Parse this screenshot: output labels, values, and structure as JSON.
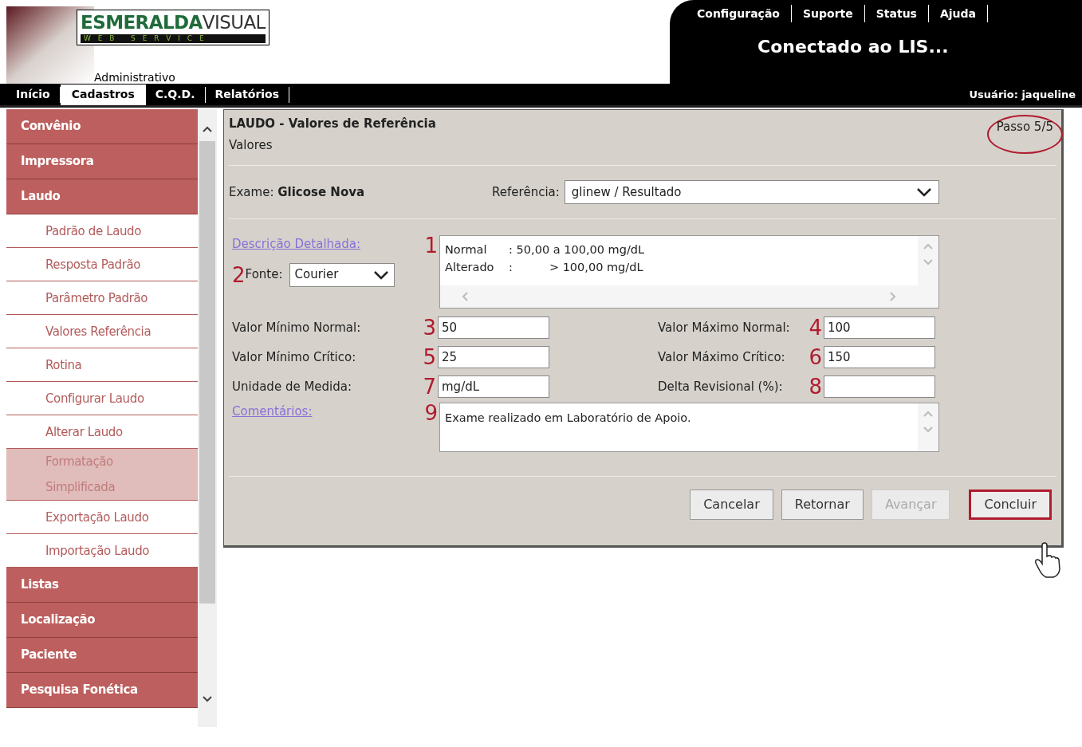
{
  "header": {
    "logo_text": "ESMERALDA",
    "logo_text2": "VISUAL",
    "logo_sub": "W E B   S E R V I C E",
    "area": "Administrativo",
    "top_links": [
      "Configuração",
      "Suporte",
      "Status",
      "Ajuda"
    ],
    "banner": "Conectado ao LIS...",
    "user": "Usuário: jaqueline"
  },
  "nav_tabs": [
    {
      "label": "Início",
      "selected": false
    },
    {
      "label": "Cadastros",
      "selected": true
    },
    {
      "label": "C.Q.D.",
      "selected": false
    },
    {
      "label": "Relatórios",
      "selected": false
    }
  ],
  "sidebar": {
    "items": [
      {
        "label": "Convênio",
        "kind": "category",
        "selected": false
      },
      {
        "label": "Impressora",
        "kind": "category",
        "selected": false
      },
      {
        "label": "Laudo",
        "kind": "category",
        "selected": false
      },
      {
        "label": "Padrão de Laudo",
        "kind": "subitem",
        "selected": false
      },
      {
        "label": "Resposta Padrão",
        "kind": "subitem",
        "selected": false
      },
      {
        "label": "Parâmetro Padrão",
        "kind": "subitem",
        "selected": false
      },
      {
        "label": "Valores Referência",
        "kind": "subitem",
        "selected": false
      },
      {
        "label": "Rotina",
        "kind": "subitem",
        "selected": false
      },
      {
        "label": "Configurar Laudo",
        "kind": "subitem",
        "selected": false
      },
      {
        "label": "Alterar Laudo",
        "kind": "subitem",
        "selected": false
      },
      {
        "label": "Formatação Simplificada",
        "kind": "subitem",
        "selected": true
      },
      {
        "label": "Exportação Laudo",
        "kind": "subitem",
        "selected": false
      },
      {
        "label": "Importação Laudo",
        "kind": "subitem",
        "selected": false
      },
      {
        "label": "Listas",
        "kind": "category",
        "selected": false
      },
      {
        "label": "Localização",
        "kind": "category",
        "selected": false
      },
      {
        "label": "Paciente",
        "kind": "category",
        "selected": false
      },
      {
        "label": "Pesquisa Fonética",
        "kind": "category",
        "selected": false
      }
    ]
  },
  "panel": {
    "title": "LAUDO - Valores de Referência",
    "subtitle": "Valores",
    "step": "Passo 5/5",
    "exam_label": "Exame:",
    "exam_value": "Glicose Nova",
    "reference_label": "Referência:",
    "reference_value": "glinew / Resultado",
    "description_link": "Descrição Detalhada:",
    "description_marker": "1",
    "description_lines": [
      "Normal      : 50,00 a 100,00 mg/dL",
      "Alterado    :          > 100,00 mg/dL"
    ],
    "font_marker": "2",
    "font_label": "Fonte:",
    "font_value": "Courier",
    "fields": [
      {
        "label": "Valor Mínimo Normal:",
        "marker": "3",
        "value": "50"
      },
      {
        "label": "Valor Máximo Normal:",
        "marker": "4",
        "value": "100"
      },
      {
        "label": "Valor Mínimo Crítico:",
        "marker": "5",
        "value": "25"
      },
      {
        "label": "Valor Máximo Crítico:",
        "marker": "6",
        "value": "150"
      },
      {
        "label": "Unidade de Medida:",
        "marker": "7",
        "value": "mg/dL"
      },
      {
        "label": "Delta Revisional (%):",
        "marker": "8"
      }
    ],
    "comments_link": "Comentários:",
    "comments_marker": "9",
    "comments_value": "Exame realizado em Laboratório de Apoio.",
    "buttons": [
      {
        "label": "Cancelar",
        "disabled": false,
        "highlighted": false
      },
      {
        "label": "Retornar",
        "disabled": false,
        "highlighted": false
      },
      {
        "label": "Avançar",
        "disabled": true,
        "highlighted": false
      },
      {
        "label": "Concluir",
        "disabled": false,
        "highlighted": true
      }
    ]
  }
}
